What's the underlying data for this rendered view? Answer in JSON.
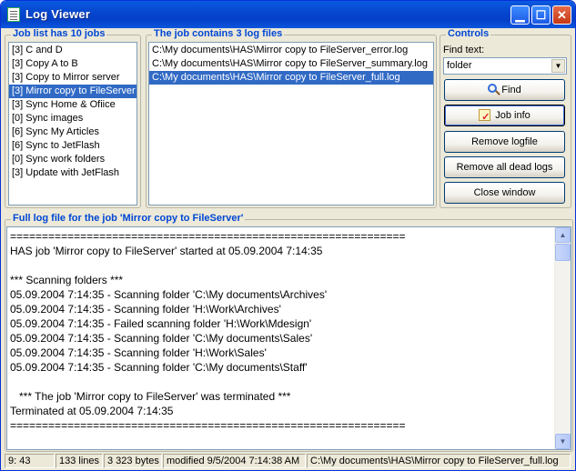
{
  "window": {
    "title": "Log Viewer"
  },
  "jobs": {
    "legend": "Job list has 10 jobs",
    "items": [
      "[3] C and D",
      "[3] Copy A to B",
      "[3] Copy to Mirror server",
      "[3] Mirror copy to FileServer",
      "[3] Sync Home & Ofiice",
      "[0] Sync images",
      "[6] Sync My Articles",
      "[6] Sync to JetFlash",
      "[0] Sync work folders",
      "[3] Update with JetFlash"
    ],
    "selected_index": 3
  },
  "logfiles": {
    "legend": "The job contains 3 log files",
    "items": [
      "C:\\My documents\\HAS\\Mirror copy to FileServer_error.log",
      "C:\\My documents\\HAS\\Mirror copy to FileServer_summary.log",
      "C:\\My documents\\HAS\\Mirror copy to FileServer_full.log"
    ],
    "selected_index": 2
  },
  "controls": {
    "legend": "Controls",
    "find_label": "Find text:",
    "find_value": "folder",
    "find_button": "Find",
    "jobinfo_button": "Job info",
    "remove_button": "Remove logfile",
    "remove_dead_button": "Remove all dead logs",
    "close_button": "Close window"
  },
  "log": {
    "legend": "Full log file for the job 'Mirror copy to FileServer'",
    "lines": [
      "==============================================================",
      "HAS job 'Mirror copy to FileServer' started at 05.09.2004 7:14:35",
      "",
      "*** Scanning folders ***",
      "05.09.2004 7:14:35 - Scanning folder 'C:\\My documents\\Archives'",
      "05.09.2004 7:14:35 - Scanning folder 'H:\\Work\\Archives'",
      "05.09.2004 7:14:35 - Failed scanning folder 'H:\\Work\\Mdesign'",
      "05.09.2004 7:14:35 - Scanning folder 'C:\\My documents\\Sales'",
      "05.09.2004 7:14:35 - Scanning folder 'H:\\Work\\Sales'",
      "05.09.2004 7:14:35 - Scanning folder 'C:\\My documents\\Staff'",
      "",
      "   *** The job 'Mirror copy to FileServer' was terminated ***",
      "Terminated at 05.09.2004 7:14:35",
      "=============================================================="
    ]
  },
  "status": {
    "position": "9: 43",
    "lines": "133 lines",
    "bytes": "3 323 bytes",
    "modified": "modified 9/5/2004 7:14:38 AM",
    "path": "C:\\My documents\\HAS\\Mirror copy to FileServer_full.log"
  }
}
